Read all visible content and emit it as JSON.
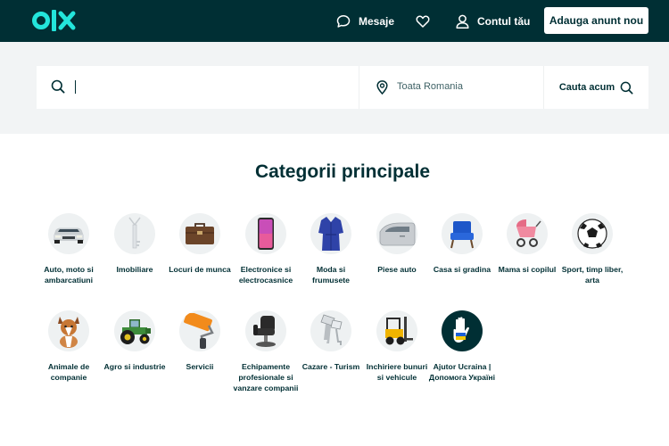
{
  "header": {
    "messages_label": "Mesaje",
    "account_label": "Contul tău",
    "post_ad_label": "Adauga anunt nou"
  },
  "search": {
    "query_value": "",
    "location_value": "Toata Romania",
    "submit_label": "Cauta acum"
  },
  "categories_section": {
    "title": "Categorii principale",
    "items": [
      {
        "label": "Auto, moto si ambarcatiuni",
        "icon": "car-icon"
      },
      {
        "label": "Imobiliare",
        "icon": "keys-icon"
      },
      {
        "label": "Locuri de munca",
        "icon": "briefcase-icon"
      },
      {
        "label": "Electronice si electrocasnice",
        "icon": "phone-icon"
      },
      {
        "label": "Moda si frumusete",
        "icon": "dress-icon"
      },
      {
        "label": "Piese auto",
        "icon": "car-door-icon"
      },
      {
        "label": "Casa si gradina",
        "icon": "armchair-icon"
      },
      {
        "label": "Mama si copilul",
        "icon": "stroller-icon"
      },
      {
        "label": "Sport, timp liber, arta",
        "icon": "football-icon"
      },
      {
        "label": "Animale de companie",
        "icon": "dog-icon"
      },
      {
        "label": "Agro si industrie",
        "icon": "tractor-icon"
      },
      {
        "label": "Servicii",
        "icon": "paint-roller-icon"
      },
      {
        "label": "Echipamente profesionale si vanzare companii",
        "icon": "salon-chair-icon"
      },
      {
        "label": "Cazare - Turism",
        "icon": "room-keys-icon"
      },
      {
        "label": "Inchiriere bunuri si vehicule",
        "icon": "forklift-icon"
      },
      {
        "label": "Ajutor Ucraina | Допомога Україні",
        "icon": "ukraine-hand-icon"
      }
    ]
  }
}
